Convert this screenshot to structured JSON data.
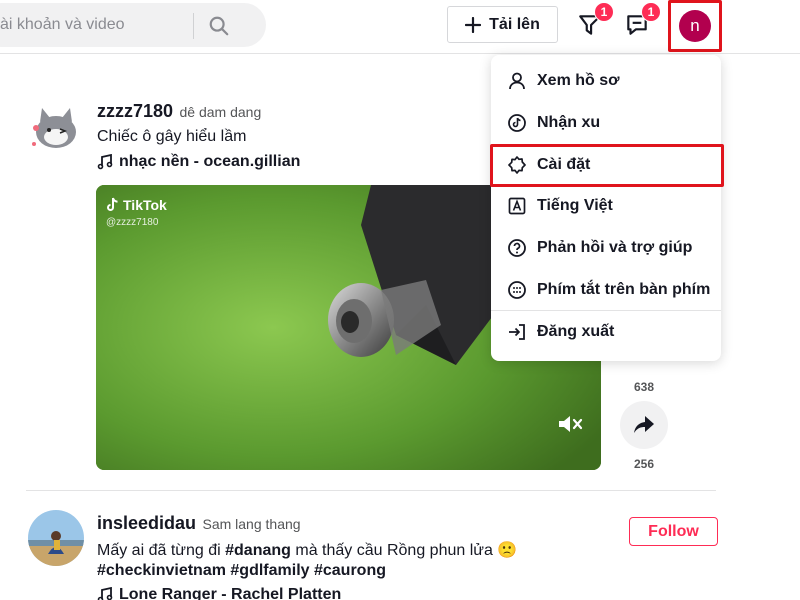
{
  "header": {
    "search_placeholder": "ài khoản và video",
    "upload_label": "Tải lên",
    "inbox_badge": "1",
    "messages_badge": "1",
    "avatar_letter": "n"
  },
  "menu": {
    "items": [
      {
        "label": "Xem hồ sơ",
        "icon": "user-icon"
      },
      {
        "label": "Nhận xu",
        "icon": "tiktok-coin-icon"
      },
      {
        "label": "Cài đặt",
        "icon": "gear-icon"
      },
      {
        "label": "Tiếng Việt",
        "icon": "language-icon"
      },
      {
        "label": "Phản hồi và trợ giúp",
        "icon": "help-icon"
      },
      {
        "label": "Phím tắt trên bàn phím",
        "icon": "keyboard-icon"
      },
      {
        "label": "Đăng xuất",
        "icon": "logout-icon"
      }
    ]
  },
  "posts": [
    {
      "username": "zzzz7180",
      "nickname": "dê dam dang",
      "caption": "Chiếc ô gây hiểu lầm",
      "music": "nhạc nền - ocean.gillian",
      "watermark_brand": "TikTok",
      "watermark_user": "@zzzz7180",
      "comments_count": "638",
      "shares_count": "256"
    },
    {
      "username": "insleedidau",
      "nickname": "Sam lang thang",
      "caption_prefix": "Mấy ai đã từng đi",
      "caption_tag1": "#danang",
      "caption_suffix": "mà thấy cầu Rồng phun lửa 🙁",
      "hashtags": "#checkinvietnam #gdlfamily #caurong",
      "music": "Lone Ranger - Rachel Platten",
      "follow_label": "Follow"
    }
  ],
  "colors": {
    "brand": "#fe2c55",
    "highlight": "#e0141c",
    "avatar_bg": "#b2004e"
  }
}
